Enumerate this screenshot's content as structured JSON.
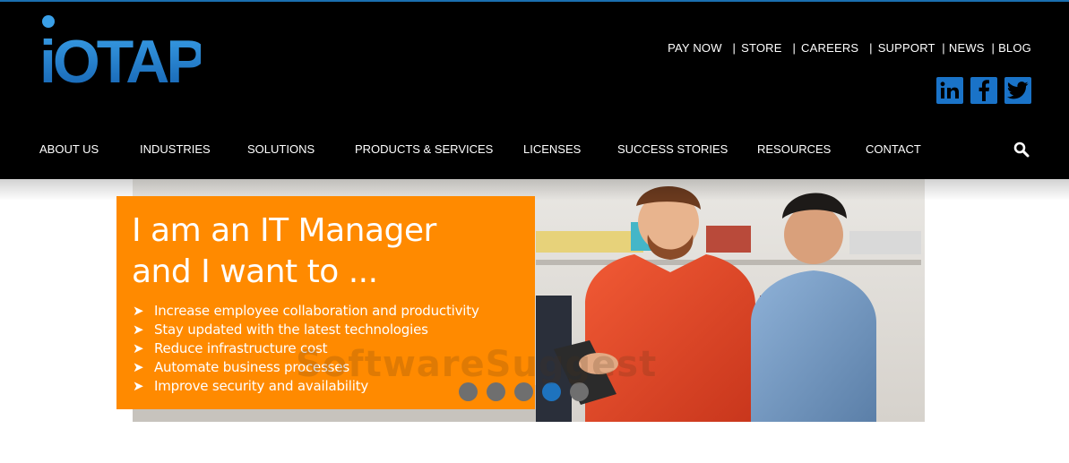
{
  "header": {
    "logo_text": "iOTAP",
    "utility_links": [
      "PAY NOW",
      "STORE",
      "CAREERS",
      "SUPPORT",
      "NEWS",
      "BLOG"
    ],
    "social": [
      "linkedin-icon",
      "facebook-icon",
      "twitter-icon"
    ]
  },
  "nav": {
    "items": [
      "ABOUT US",
      "INDUSTRIES",
      "SOLUTIONS",
      "PRODUCTS & SERVICES",
      "LICENSES",
      "SUCCESS STORIES",
      "RESOURCES",
      "CONTACT"
    ],
    "search_icon": "search-icon"
  },
  "hero": {
    "title_line1": "I am an IT Manager",
    "title_line2": "and I want to ...",
    "bullet_glyph": "➤",
    "bullets": [
      "Increase employee collaboration and productivity",
      "Stay updated with the latest technologies",
      "Reduce infrastructure cost",
      "Automate business processes",
      "Improve security and availability"
    ],
    "slides_total": 5,
    "active_slide": 4,
    "watermark": "SoftwareSuggest"
  },
  "colors": {
    "brand_blue": "#1e73be",
    "orange": "#ff8a00",
    "header_bg": "#000000"
  }
}
